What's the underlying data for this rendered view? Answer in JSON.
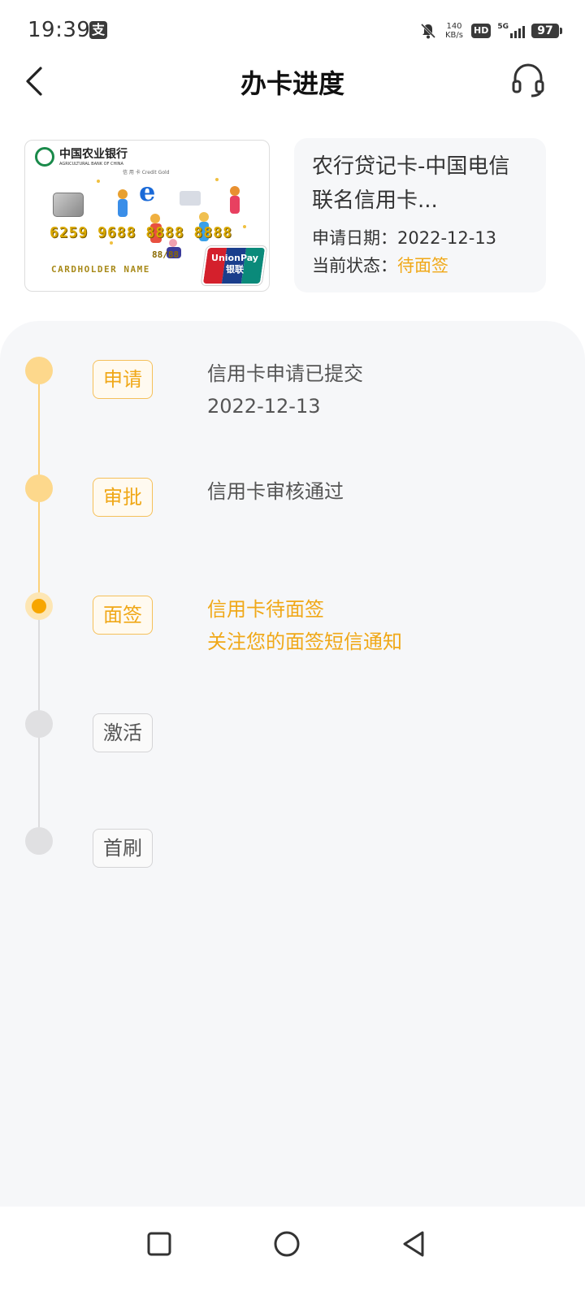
{
  "status_bar": {
    "time": "19:39",
    "app_icon": "alipay-icon",
    "net_speed_value": "140",
    "net_speed_unit": "KB/s",
    "hd": "HD",
    "network": "5G",
    "battery": "97"
  },
  "header": {
    "title": "办卡进度",
    "back_icon": "chevron-left-icon",
    "service_icon": "headset-icon"
  },
  "card": {
    "bank_name": "中国农业银行",
    "bank_name_en": "AGRICULTURAL BANK OF CHINA",
    "card_sub": "信 用 卡       Credit Gold",
    "number": "6259 9688 8888 8888",
    "expiry": "88/88",
    "holder": "CARDHOLDER NAME",
    "network_brand": "UnionPay",
    "network_brand_cn": "银联"
  },
  "card_info": {
    "product_name": "农行贷记卡-中国电信联名信用卡...",
    "apply_date_label": "申请日期：",
    "apply_date": "2022-12-13",
    "status_label": "当前状态：",
    "status": "待面签",
    "status_color": "#f0a818"
  },
  "steps": [
    {
      "badge": "申请",
      "state": "done",
      "line1": "信用卡申请已提交",
      "line2": "2022-12-13"
    },
    {
      "badge": "审批",
      "state": "done",
      "line1": "信用卡审核通过",
      "line2": ""
    },
    {
      "badge": "面签",
      "state": "current",
      "line1": "信用卡待面签",
      "line2": "关注您的面签短信通知"
    },
    {
      "badge": "激活",
      "state": "pending",
      "line1": "",
      "line2": ""
    },
    {
      "badge": "首刷",
      "state": "pending",
      "line1": "",
      "line2": ""
    }
  ],
  "colors": {
    "accent": "#f0a818",
    "done_dot": "#fdd88c",
    "pending_dot": "#e0e0e2",
    "panel_bg": "#f6f7f9"
  },
  "nav": {
    "recent_icon": "square-icon",
    "home_icon": "circle-icon",
    "back_icon": "triangle-back-icon"
  }
}
